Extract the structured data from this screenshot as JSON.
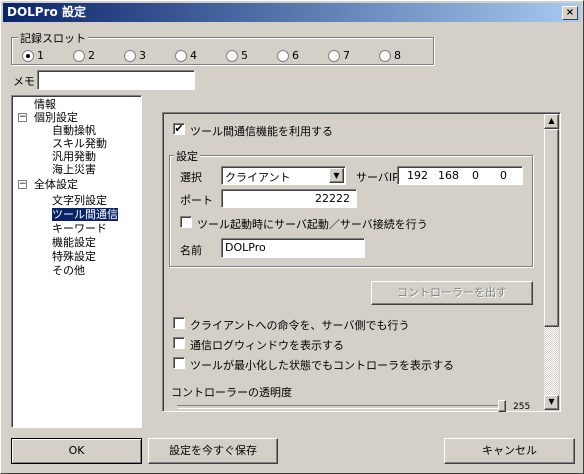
{
  "window": {
    "title": "DOLPro 設定",
    "close": "×"
  },
  "slots": {
    "label": "記録スロット",
    "items": [
      "1",
      "2",
      "3",
      "4",
      "5",
      "6",
      "7",
      "8"
    ],
    "selected_index": 0
  },
  "memo": {
    "label": "メモ",
    "value": ""
  },
  "tree": {
    "minus": "−",
    "items": [
      {
        "label": "情報"
      },
      {
        "label": "個別設定"
      },
      {
        "label": "自動操帆"
      },
      {
        "label": "スキル発動"
      },
      {
        "label": "汎用発動"
      },
      {
        "label": "海上災害"
      },
      {
        "label": "全体設定"
      },
      {
        "label": "文字列設定"
      },
      {
        "label": "ツール間通信"
      },
      {
        "label": "キーワード"
      },
      {
        "label": "機能設定"
      },
      {
        "label": "特殊設定"
      },
      {
        "label": "その他"
      }
    ]
  },
  "panel": {
    "enable_label": "ツール間通信機能を利用する",
    "enable_checked": true,
    "settings": {
      "label": "設定",
      "select_label": "選択",
      "select_value": "クライアント",
      "server_ip_label": "サーバIP",
      "ip": [
        "192",
        "168",
        "0",
        "0"
      ],
      "port_label": "ポート",
      "port_value": "22222",
      "autostart_label": "ツール起動時にサーバ起動／サーバ接続を行う",
      "autostart_checked": false,
      "name_label": "名前",
      "name_value": "DOLPro"
    },
    "controller_button": "コントローラーを出す",
    "option1": "クライアントへの命令を、サーバ側でも行う",
    "option2": "通信ログウィンドウを表示する",
    "option3": "ツールが最小化した状態でもコントローラを表示する",
    "transparency_label": "コントローラーの透明度",
    "transparency_value": "255",
    "scroll_up": "▲",
    "scroll_down": "▼"
  },
  "buttons": {
    "ok": "OK",
    "save_now": "設定を今すぐ保存",
    "cancel": "キャンセル"
  },
  "checkmark": "✔"
}
